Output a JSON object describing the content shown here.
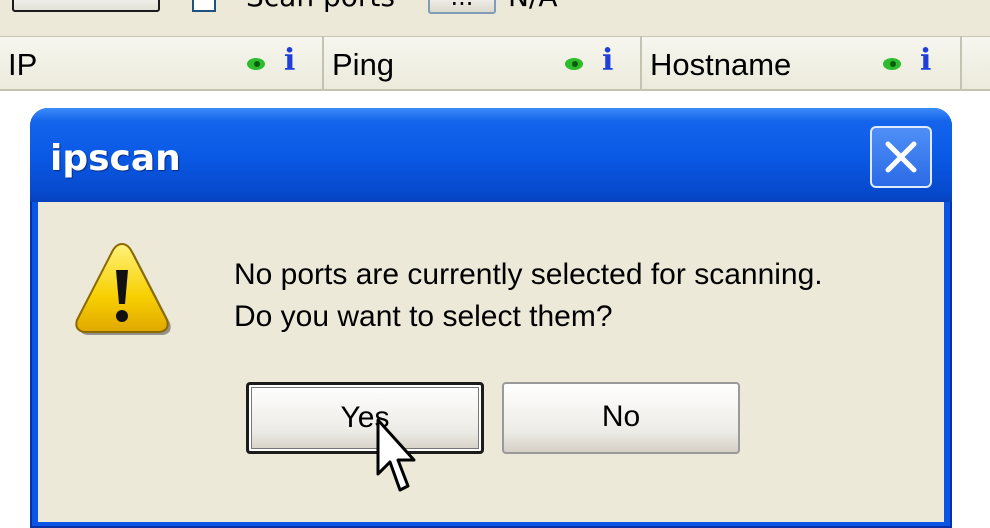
{
  "toolbar": {
    "scan_ports_label": "Scan ports",
    "dots_label": "...",
    "value": "N/A"
  },
  "columns": [
    {
      "label": "IP"
    },
    {
      "label": "Ping"
    },
    {
      "label": "Hostname"
    }
  ],
  "dialog": {
    "title": "ipscan",
    "message_line1": "No ports are currently selected for scanning.",
    "message_line2": "Do you want to select them?",
    "yes_label": "Yes",
    "no_label": "No"
  },
  "colors": {
    "titlebar": "#0a5ae6",
    "dialog_body": "#ece9d8",
    "eye_icon": "#2bbd2b",
    "info_icon": "#1f3fd8"
  }
}
